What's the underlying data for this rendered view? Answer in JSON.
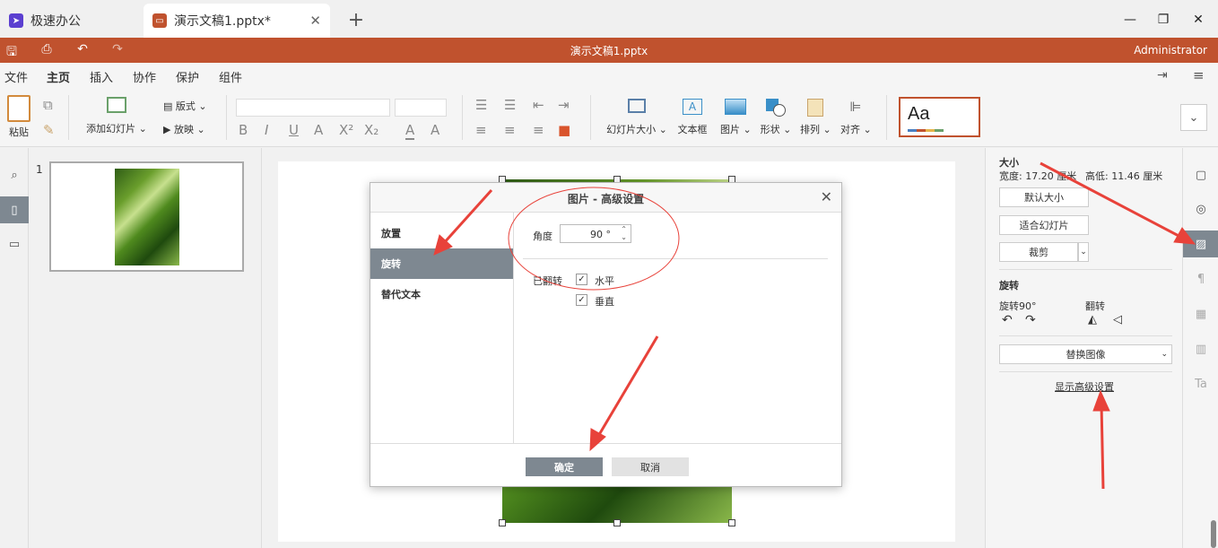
{
  "tabs": [
    {
      "label": "极速办公",
      "icon": "rocket-icon",
      "color": "#5b3fd0"
    },
    {
      "label": "演示文稿1.pptx*",
      "icon": "presentation-icon",
      "color": "#c0522e"
    }
  ],
  "window": {
    "title": "演示文稿1.pptx",
    "user": "Administrator"
  },
  "menu": [
    "文件",
    "主页",
    "插入",
    "协作",
    "保护",
    "组件"
  ],
  "ribbon": {
    "paste": "粘贴",
    "add_slide": "添加幻灯片",
    "layout": "版式",
    "play": "放映",
    "slide_size": "幻灯片大小",
    "textbox": "文本框",
    "picture": "图片",
    "shape": "形状",
    "arrange": "排列",
    "align": "对齐",
    "theme_sample": "Aa"
  },
  "thumbnails": [
    {
      "number": "1"
    }
  ],
  "right_panel": {
    "size_title": "大小",
    "width": "宽度: 17.20 厘米",
    "height": "高低: 11.46 厘米",
    "default_size": "默认大小",
    "fit_slide": "适合幻灯片",
    "crop": "裁剪",
    "rotate_title": "旋转",
    "rotate90": "旋转90°",
    "flip": "翻转",
    "replace_image": "替换图像",
    "show_advanced": "显示高级设置"
  },
  "dialog": {
    "title": "图片 - 高级设置",
    "nav": [
      "放置",
      "旋转",
      "替代文本"
    ],
    "active_nav": 1,
    "angle_label": "角度",
    "angle_value": "90 °",
    "flipped_label": "已翻转",
    "horizontal": "水平",
    "vertical": "垂直",
    "horizontal_checked": true,
    "vertical_checked": true,
    "ok": "确定",
    "cancel": "取消"
  },
  "colors": {
    "accent": "#c0522e",
    "annotation": "#e8423a",
    "dialog_active": "#7e8891"
  }
}
